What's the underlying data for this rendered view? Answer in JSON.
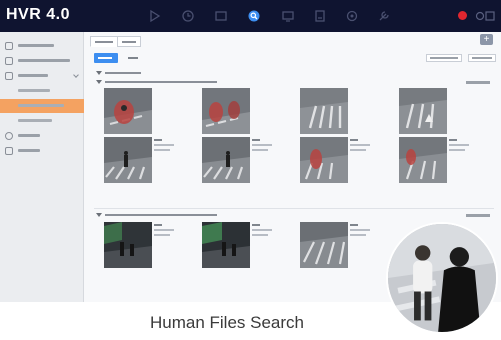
{
  "app": {
    "title": "HVR 4.0",
    "accent": "#f4a261",
    "topbar_color": "#0f1430",
    "alarm_color": "#e0262f",
    "nav_icons": [
      "playback-icon",
      "time-icon",
      "layout-icon",
      "search-icon",
      "monitor-icon",
      "storage-icon",
      "settings-icon",
      "tools-icon"
    ]
  },
  "sidebar": {
    "items": [
      {
        "label": "",
        "icon": "grid-icon",
        "kind": "top"
      },
      {
        "label": "",
        "icon": "grid-icon",
        "kind": "top"
      },
      {
        "label": "",
        "icon": "grid-icon",
        "kind": "top-expanded"
      },
      {
        "label": "",
        "kind": "sub"
      },
      {
        "label": "",
        "kind": "sub-active"
      },
      {
        "label": "",
        "kind": "sub"
      },
      {
        "label": "",
        "icon": "gear-icon",
        "kind": "top"
      },
      {
        "label": "",
        "icon": "tools-icon",
        "kind": "top"
      }
    ]
  },
  "toolbar": {
    "tabs": [
      "",
      ""
    ],
    "buttons": [
      "",
      ""
    ],
    "right_buttons": [
      "",
      ""
    ]
  },
  "results": {
    "groups": [
      {
        "header": "",
        "count": ""
      },
      {
        "header": "",
        "count": ""
      }
    ]
  },
  "caption": "Human Files Search"
}
